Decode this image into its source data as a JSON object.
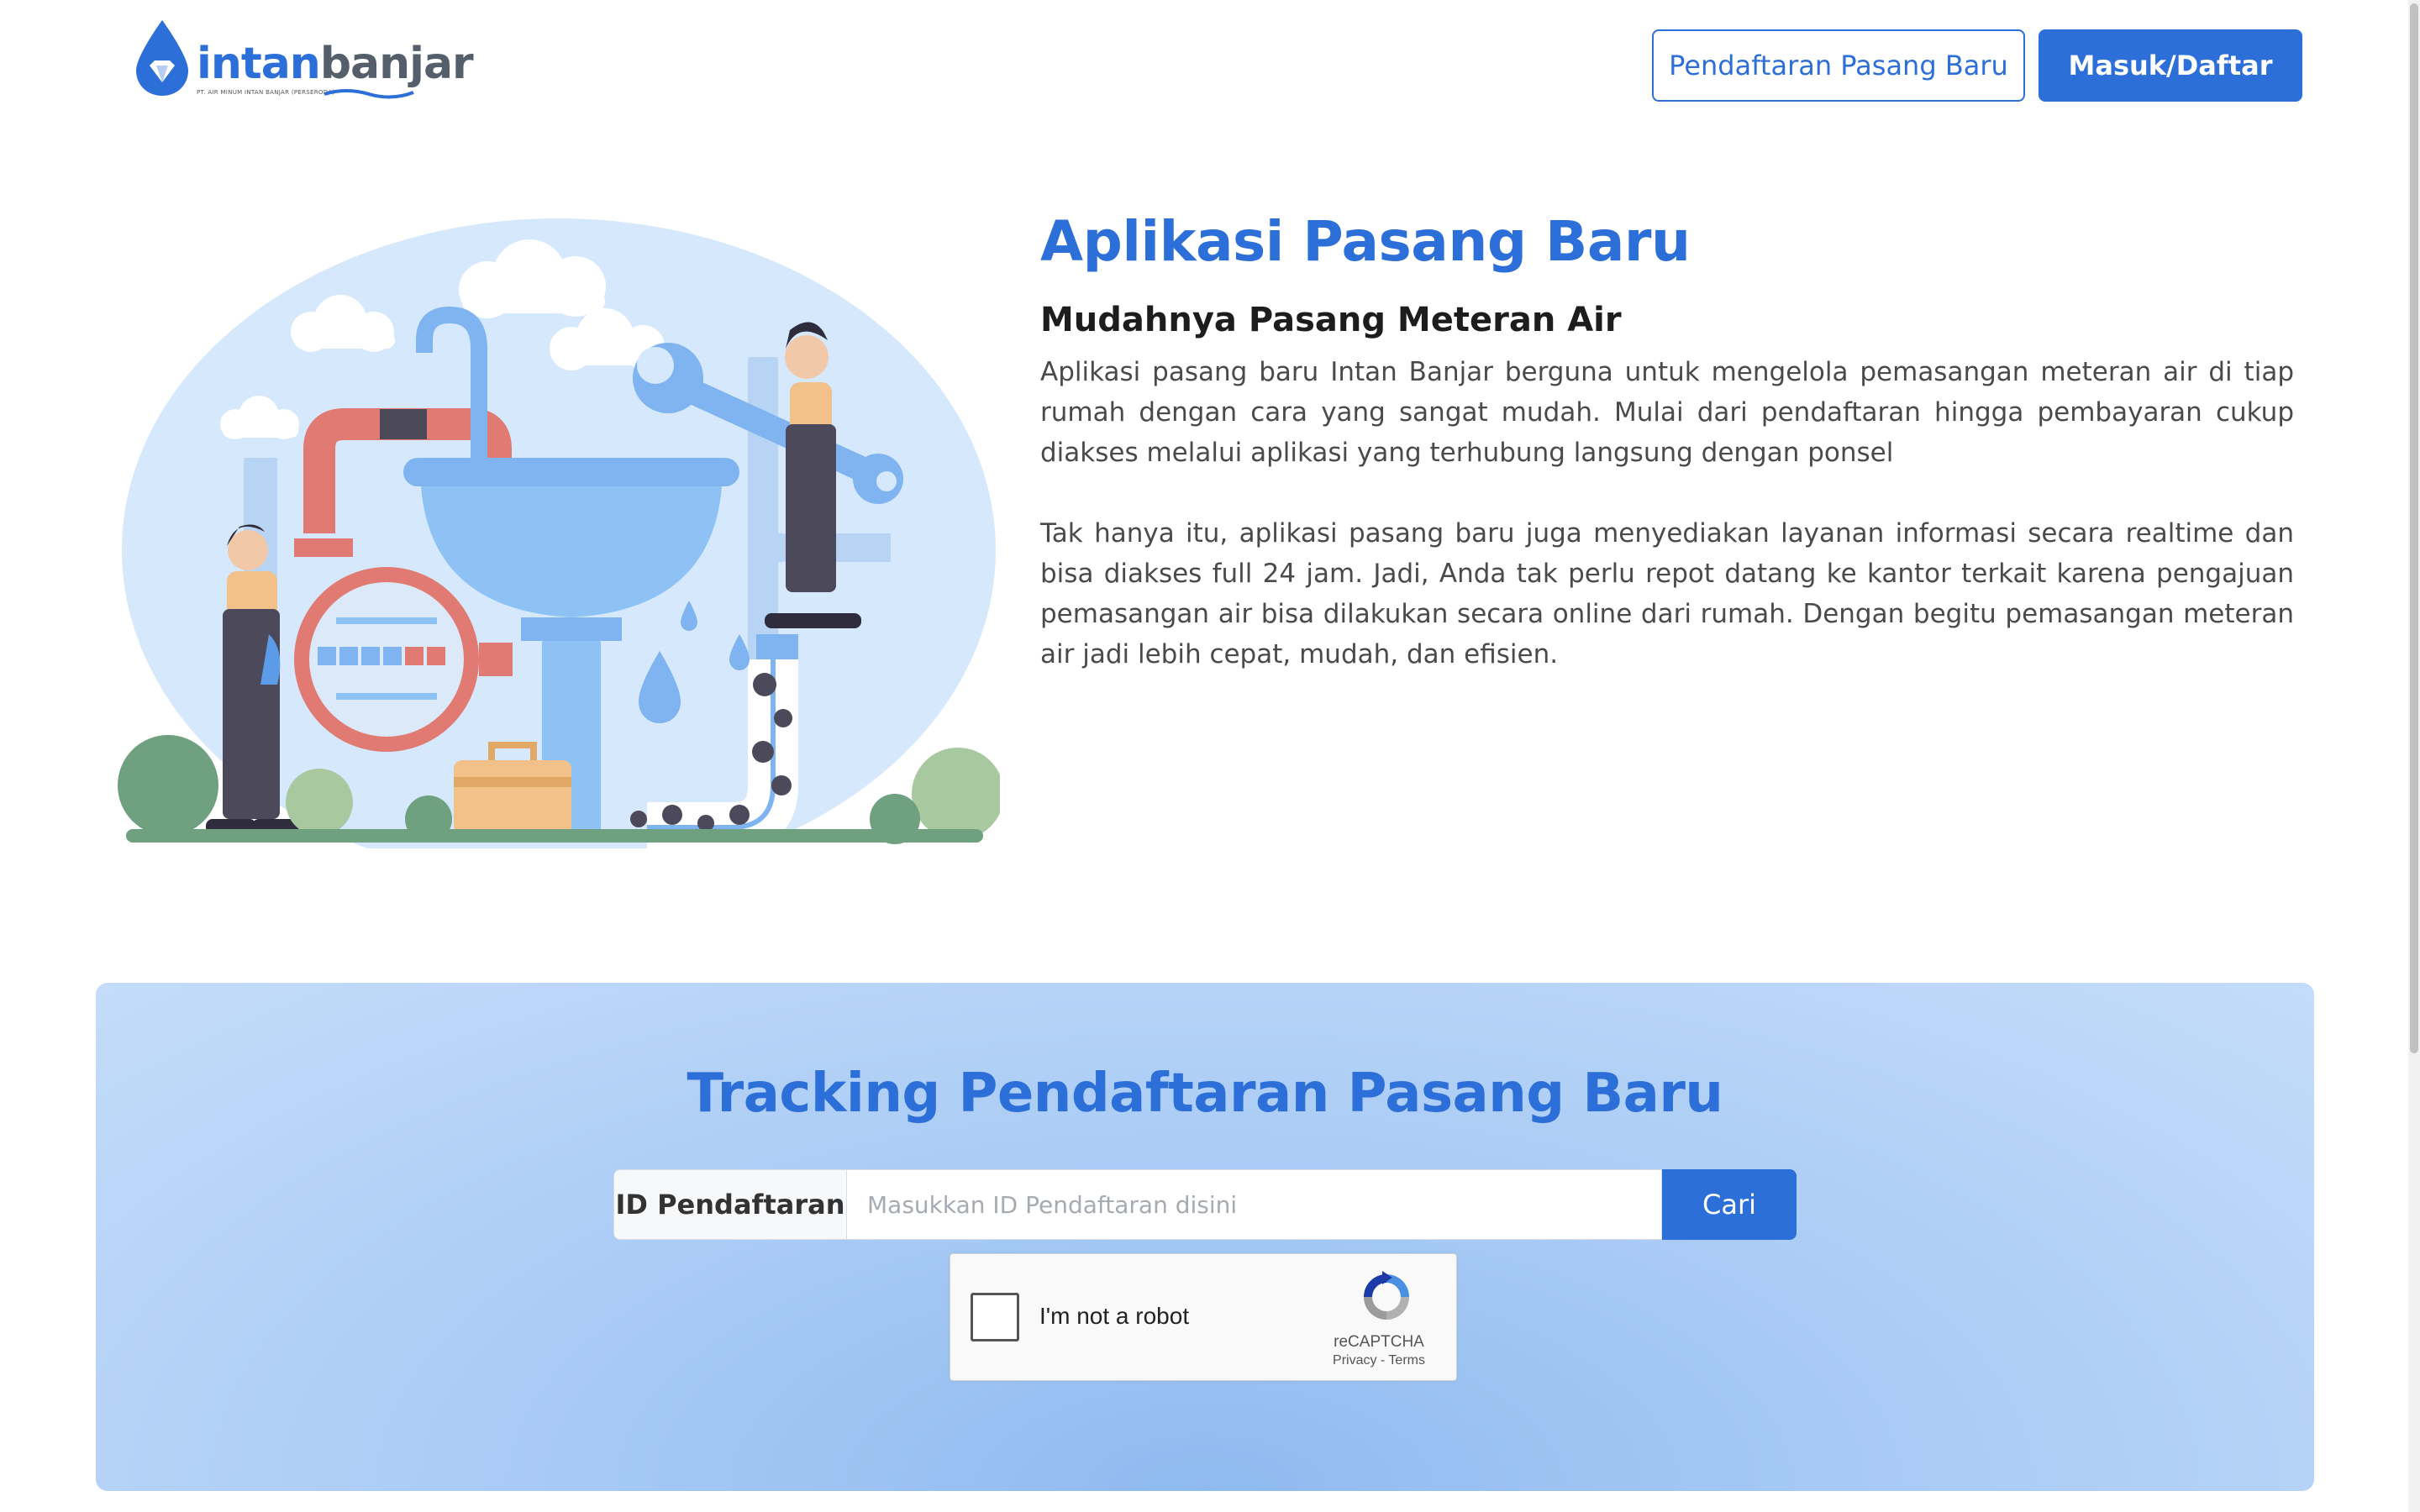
{
  "header": {
    "logo": {
      "part1": "intan",
      "part2": "banjar",
      "tagline": "PT. AIR MINUM INTAN BANJAR (PERSERODA)"
    },
    "register_new_label": "Pendaftaran Pasang Baru",
    "login_label": "Masuk/Daftar"
  },
  "hero": {
    "title": "Aplikasi Pasang Baru",
    "subtitle": "Mudahnya Pasang Meteran Air",
    "paragraphs": [
      "Aplikasi pasang baru Intan Banjar berguna untuk mengelola pemasangan meteran air di tiap rumah dengan cara yang sangat mudah. Mulai dari pendaftaran hingga pembayaran cukup diakses melalui aplikasi yang terhubung langsung dengan ponsel",
      "Tak hanya itu, aplikasi pasang baru juga menyediakan layanan informasi secara realtime dan bisa diakses full 24 jam. Jadi, Anda tak perlu repot datang ke kantor terkait karena pengajuan pemasangan air bisa dilakukan secara online dari rumah. Dengan begitu pemasangan meteran air jadi lebih cepat, mudah, dan efisien."
    ],
    "illustration": "plumbers-repairing-sink-illustration"
  },
  "tracking": {
    "title": "Tracking Pendaftaran Pasang Baru",
    "id_label": "ID Pendaftaran",
    "input_value": "",
    "input_placeholder": "Masukkan ID Pendaftaran disini",
    "search_label": "Cari",
    "captcha": {
      "checkbox_label": "I'm not a robot",
      "brand": "reCAPTCHA",
      "links": "Privacy - Terms",
      "checked": false
    }
  },
  "colors": {
    "primary": "#2d6fd8",
    "logo_gray": "#555e6b",
    "section_bg": "#a9cbf5"
  }
}
